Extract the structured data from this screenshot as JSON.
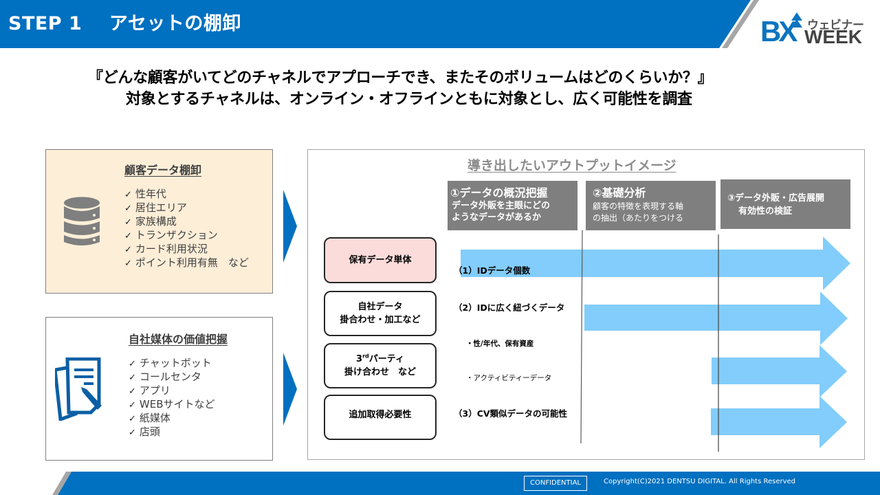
{
  "header": {
    "title": "STEP 1    アセットの棚卸",
    "logo": {
      "brand": "BX",
      "subtitle": "ウェビナー",
      "week": "WEEK"
    }
  },
  "headline": {
    "line1": "『どんな顧客がいてどのチャネルでアプローチでき、またそのボリュームはどのくらいか？』",
    "line2": "対象とするチャネルは、オンライン・オフラインともに対象とし、広く可能性を調査"
  },
  "customer_panel": {
    "title": "顧客データ棚卸",
    "icon": "database-icon",
    "items": [
      "性年代",
      "居住エリア",
      "家族構成",
      "トランザクション",
      "カード利用状況",
      "ポイント利用有無　など"
    ]
  },
  "media_panel": {
    "title": "自社媒体の価値把握",
    "icon": "document-edit-icon",
    "items": [
      "チャットボット",
      "コールセンタ",
      "アプリ",
      "WEBサイトなど",
      "紙媒体",
      "店頭"
    ]
  },
  "check_glyph": "✓",
  "output": {
    "title": "導き出したいアウトプットイメージ",
    "phases": [
      {
        "title": "①データの概況把握",
        "desc": "データ外販を主眼にどの\nようなデータがあるか"
      },
      {
        "title": "②基礎分析",
        "desc": "顧客の特徴を表現する軸\nの抽出（あたりをつける"
      },
      {
        "title": "③データ外販・広告展開",
        "desc": "有効性の検証"
      }
    ],
    "rows": [
      {
        "label": "保有データ単体",
        "highlight": true,
        "arrow_from_phase": 1
      },
      {
        "label": "自社データ\n掛合わせ・加工など",
        "highlight": false,
        "arrow_from_phase": 2
      },
      {
        "label_pre": "3",
        "label_sup": "rd",
        "label_post": "パーティ\n掛け合わせ　など",
        "highlight": false,
        "arrow_from_phase": 3
      },
      {
        "label": "追加取得必要性",
        "highlight": false,
        "arrow_from_phase": 3
      }
    ],
    "details": {
      "item1": "（1）IDデータ個数",
      "item2": "（2）IDに広く紐づくデータ",
      "sub1": "・性/年代、保有資産",
      "sub2": "・アクティビティーデータ",
      "item3": "（3）CV類似データの可能性"
    }
  },
  "colors": {
    "brand_blue": "#0070c0",
    "arrow_blue": "#82cdfc",
    "phase_gray": "#7f7f7f",
    "highlight_pink": "#fcdcdb",
    "panel_cream": "#fdeed8"
  },
  "footer": {
    "confidential": "CONFIDENTIAL",
    "copyright": "Copyright(C)2021 DENTSU DIGITAL. All Rights Reserved"
  }
}
